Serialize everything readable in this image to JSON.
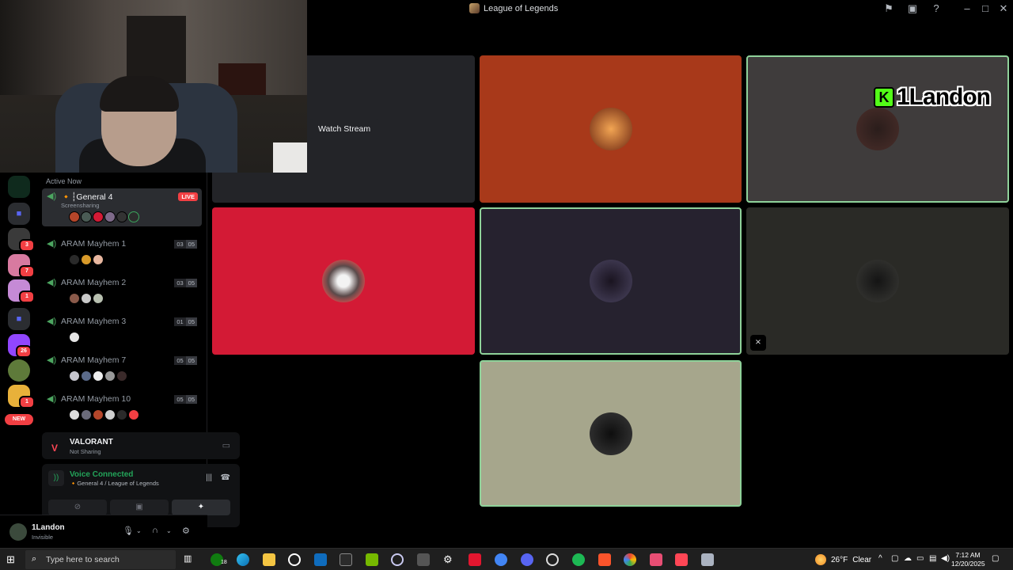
{
  "window": {
    "title": "League of Legends"
  },
  "stage": {
    "watch_stream_label": "Watch Stream",
    "streamer_overlay_name": "1Landon",
    "streamer_overlay_letter": "K"
  },
  "sidebar": {
    "section_label": "Active Now",
    "channels": [
      {
        "name": "🔸┆General 4",
        "status": "Screensharing",
        "live": "LIVE",
        "count": "",
        "limit": ""
      },
      {
        "name": "ARAM Mayhem 1",
        "count": "03",
        "limit": "05"
      },
      {
        "name": "ARAM Mayhem 2",
        "count": "03",
        "limit": "05"
      },
      {
        "name": "ARAM Mayhem 3",
        "count": "01",
        "limit": "05"
      },
      {
        "name": "ARAM Mayhem 7",
        "count": "05",
        "limit": "05"
      },
      {
        "name": "ARAM Mayhem 10",
        "count": "05",
        "limit": "05"
      }
    ]
  },
  "rail": {
    "badges": [
      "3",
      "7",
      "1",
      "26",
      "1"
    ],
    "new_label": "NEW"
  },
  "activity": {
    "game": "VALORANT",
    "status": "Not Sharing"
  },
  "voice": {
    "status": "Voice Connected",
    "channel": "🔸General 4 / League of Legends"
  },
  "user": {
    "name": "1Landon",
    "status": "Invisible"
  },
  "taskbar": {
    "search_placeholder": "Type here to search",
    "xbox_badge": "18",
    "weather_temp": "26°F",
    "weather_text": "Clear",
    "time": "7:12 AM",
    "date": "12/20/2025"
  },
  "colors": {
    "accent_live": "#f23f43",
    "voice_green": "#23a55a",
    "speaking_border": "#8fd29a",
    "tile_orange": "#a8391a",
    "tile_red": "#d31a35",
    "tile_indigo": "#26222f",
    "tile_olive": "#a6a68c"
  }
}
